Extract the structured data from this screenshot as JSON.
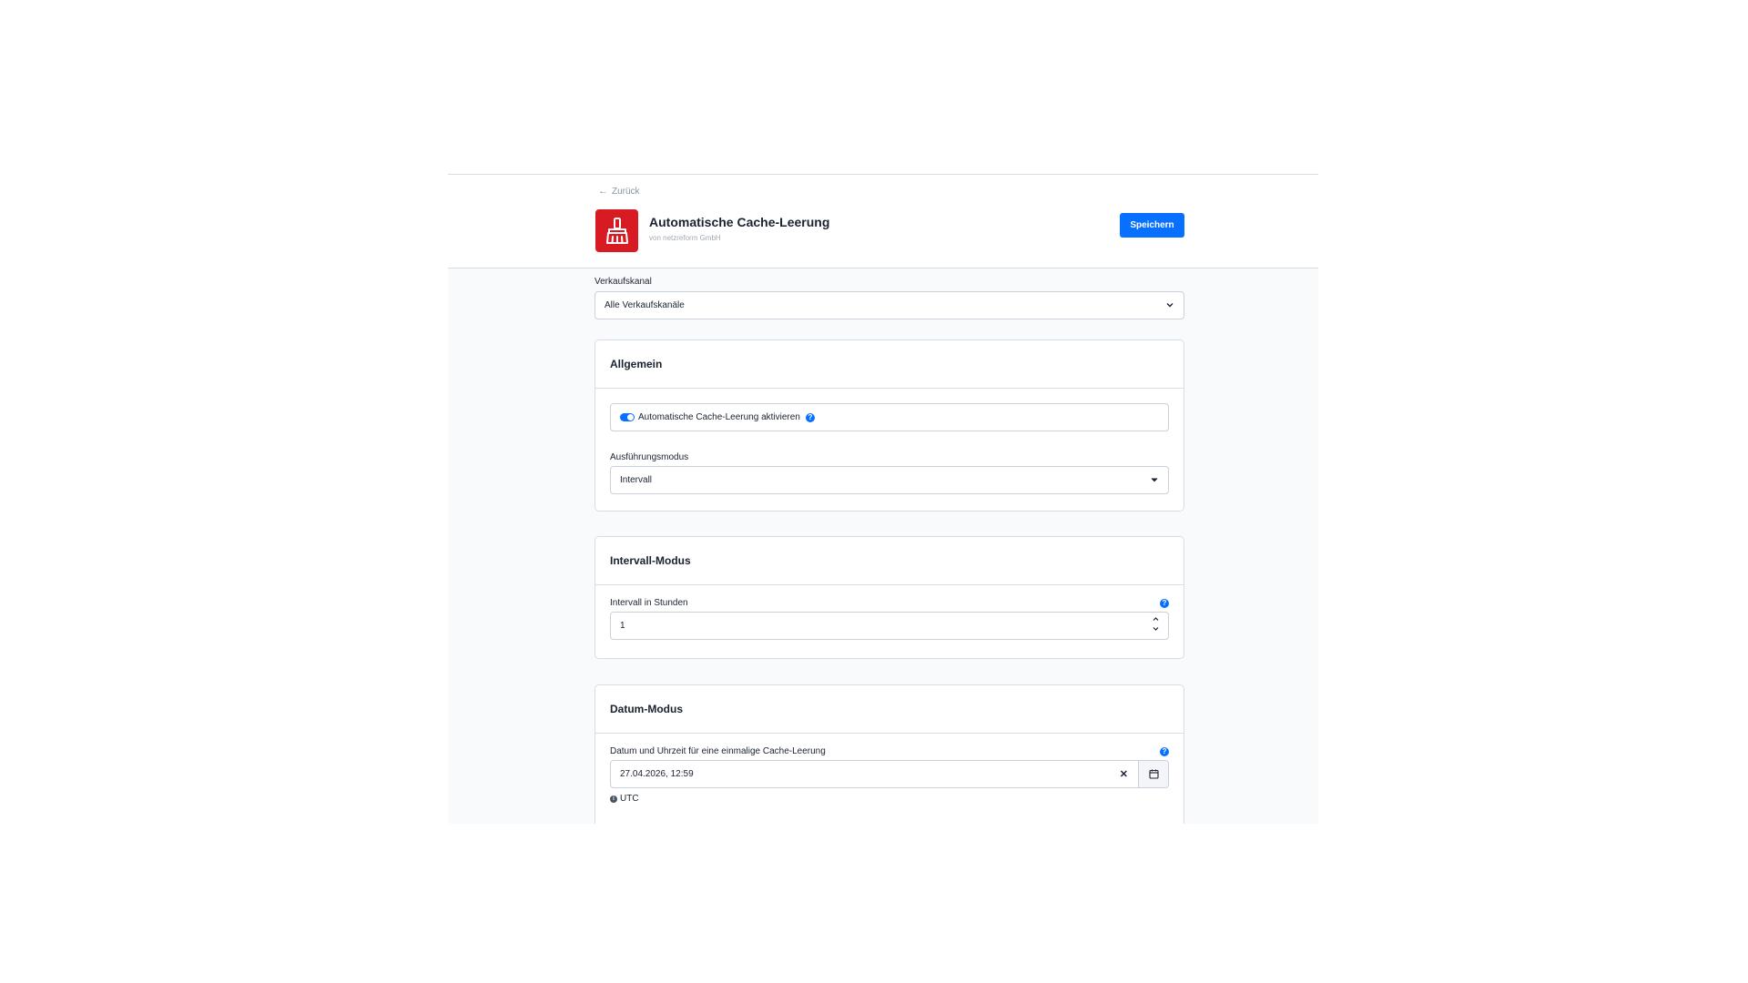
{
  "header": {
    "back_label": "Zurück",
    "app_title": "Automatische Cache-Leerung",
    "vendor": "von netzreform GmbH",
    "save_label": "Speichern",
    "icon": "broom-icon"
  },
  "sales_channel": {
    "label": "Verkaufskanal",
    "selected": "Alle Verkaufskanäle"
  },
  "general": {
    "title": "Allgemein",
    "toggle_label": "Automatische Cache-Leerung aktivieren",
    "toggle_on": true,
    "mode_label": "Ausführungsmodus",
    "mode_selected": "Intervall"
  },
  "interval": {
    "title": "Intervall-Modus",
    "hours_label": "Intervall in Stunden",
    "hours_value": "1"
  },
  "date": {
    "title": "Datum-Modus",
    "datetime_label": "Datum und Uhrzeit für eine einmalige Cache-Leerung",
    "datetime_value": "27.04.2026, 12:59",
    "timezone": "UTC"
  },
  "colors": {
    "accent": "#0870ff",
    "app_icon_bg": "#d81a22"
  }
}
